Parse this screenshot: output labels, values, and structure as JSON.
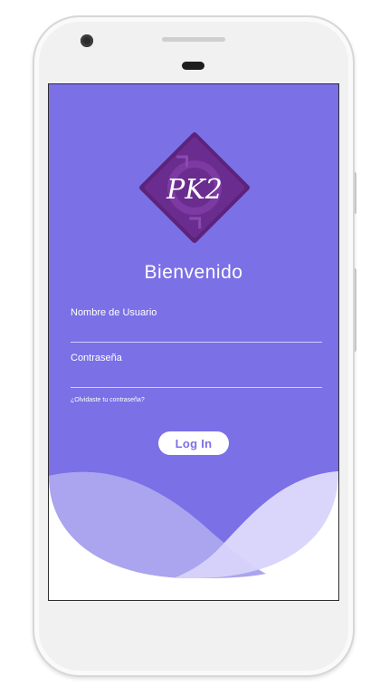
{
  "app": {
    "logo_text": "PK2",
    "welcome_title": "Bienvenido"
  },
  "login_form": {
    "username_label": "Nombre de Usuario",
    "username_value": "",
    "password_label": "Contraseña",
    "password_value": "",
    "forgot_link": "¿Olvidaste tu contraseña?",
    "login_button": "Log In"
  },
  "colors": {
    "primary": "#7b70e6",
    "wave_light": "#d9d6fb",
    "wave_mid": "#aba4ef",
    "logo_purple": "#6a2d8f"
  },
  "icons": {
    "logo": "condom-wrapper-logo"
  }
}
